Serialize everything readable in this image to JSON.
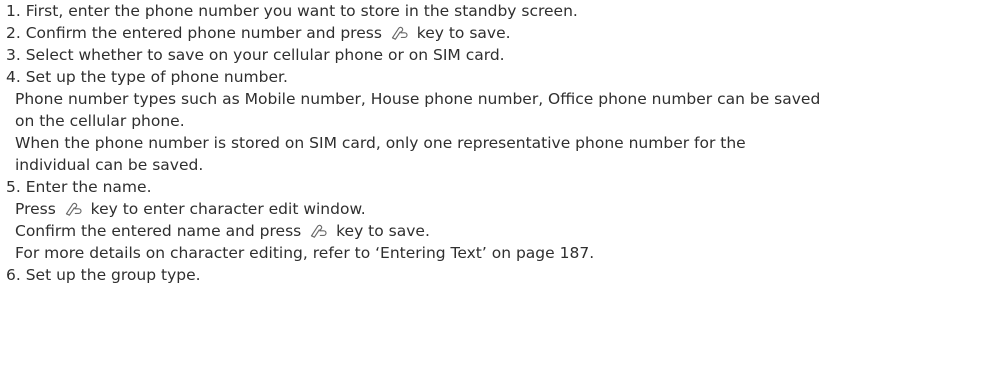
{
  "instructions": {
    "step1": "1. First, enter the phone number you want to store in the standby screen.",
    "step2_before": "2. Confirm the entered phone number and press",
    "step2_after": "key to save.",
    "step3": "3. Select whether to save on your cellular phone or on SIM card.",
    "step4": "4. Set up the type of phone number.",
    "step4_note1_line1": "Phone number types such as Mobile number, House phone number, Office phone number can be saved",
    "step4_note1_line2": "on the cellular phone.",
    "step4_note2_line1": "When the phone number is stored on SIM card, only one representative phone number for the",
    "step4_note2_line2": "individual can be saved.",
    "step5": "5. Enter the name.",
    "step5_note1_before": "Press",
    "step5_note1_after": "key to enter character edit window.",
    "step5_note2_before": "Confirm the entered name and press",
    "step5_note2_after": "key to save.",
    "step5_note3": "For more details on character editing, refer to ‘Entering Text’ on page 187.",
    "step6": "6. Set up the group type."
  },
  "icons": {
    "key": "send-key-icon"
  }
}
